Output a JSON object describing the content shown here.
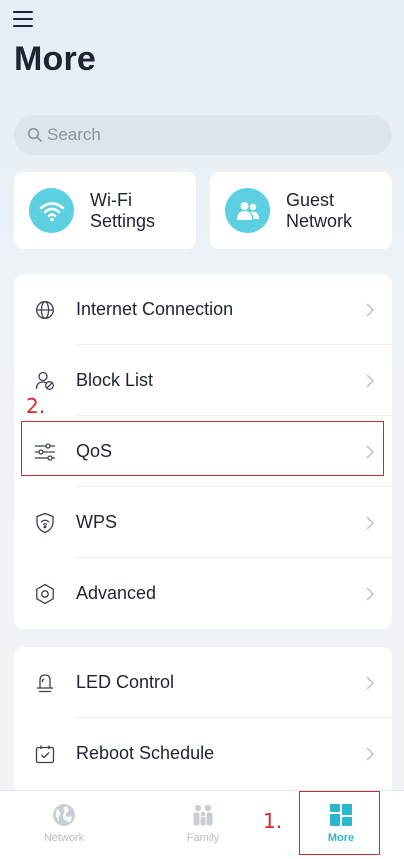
{
  "header": {
    "title": "More",
    "menu_icon": "hamburger-menu-icon"
  },
  "search": {
    "placeholder": "Search",
    "icon": "search-icon"
  },
  "quick_cards": [
    {
      "label": "Wi-Fi\nSettings",
      "icon": "wifi-icon"
    },
    {
      "label": "Guest\nNetwork",
      "icon": "guest-users-icon"
    }
  ],
  "group1": [
    {
      "label": "Internet Connection",
      "icon": "globe-icon"
    },
    {
      "label": "Block List",
      "icon": "user-block-icon"
    },
    {
      "label": "QoS",
      "icon": "sliders-icon"
    },
    {
      "label": "WPS",
      "icon": "shield-icon"
    },
    {
      "label": "Advanced",
      "icon": "hexagon-gear-icon"
    }
  ],
  "group2": [
    {
      "label": "LED Control",
      "icon": "led-lamp-icon"
    },
    {
      "label": "Reboot Schedule",
      "icon": "calendar-check-icon"
    }
  ],
  "tabbar": [
    {
      "label": "Network",
      "icon": "network-globe-icon",
      "active": false
    },
    {
      "label": "Family",
      "icon": "family-icon",
      "active": false
    },
    {
      "label": "More",
      "icon": "grid-tiles-icon",
      "active": true
    }
  ],
  "annotations": {
    "step1": "1.",
    "step2": "2."
  },
  "colors": {
    "accent": "#2ab6cd",
    "icon_bg": "#5ccfe0",
    "annotation": "#d0282f"
  }
}
